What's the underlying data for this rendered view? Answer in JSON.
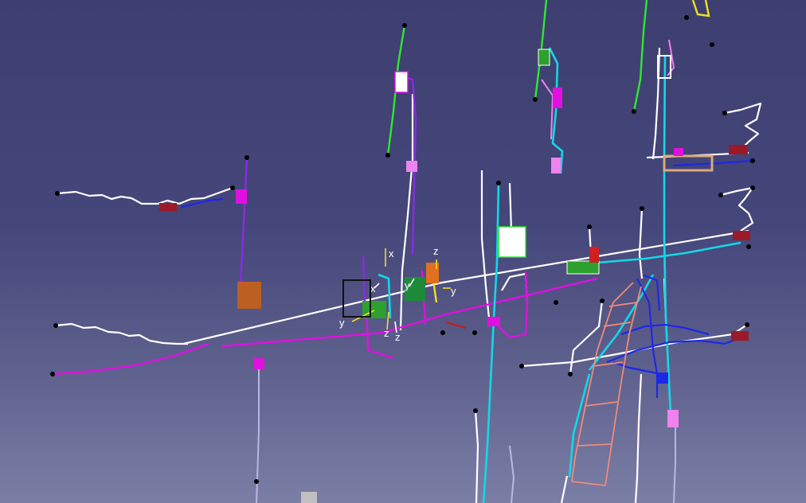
{
  "viewer": {
    "background_top": "#3e3f70",
    "background_bottom": "#7b7ea5"
  },
  "axes": {
    "axis_1": {
      "x": "x",
      "y": "y",
      "z": "z"
    },
    "axis_2": {
      "x": "x",
      "y": "y",
      "z": "z"
    },
    "axis_3": {
      "x": "x",
      "y": "y",
      "z": "z"
    }
  },
  "wire_colors": {
    "white": "#ffffff",
    "magenta": "#e010e0",
    "purple": "#8a2be2",
    "cyan": "#12d8e8",
    "green": "#2ee82e",
    "blue": "#1c28e8",
    "salmon": "#f08a7a",
    "pink": "#ee82ee",
    "lavender": "#b8b8e0",
    "yellow": "#f0e020",
    "orange": "#e07020",
    "red": "#c02020"
  }
}
